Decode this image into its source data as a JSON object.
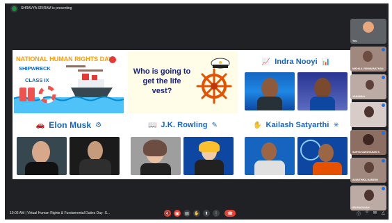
{
  "presenting_text": "SHRAVYA SRIRAM is presenting",
  "meeting": {
    "time": "10:02 AM",
    "title": "Virtual Human Rights & Fundamental Duties Day -S..."
  },
  "slide": {
    "panel1": {
      "line1": "NATIONAL HUMAN RIGHTS DAY",
      "line2": "SHIPWRECK",
      "line3": "CLASS IX"
    },
    "panel2": {
      "question": "Who is going to get the life vest?"
    },
    "panel3": {
      "name": "Indra Nooyi"
    },
    "panel4": {
      "name": "Elon Musk"
    },
    "panel5": {
      "name": "J.K. Rowling"
    },
    "panel6": {
      "name": "Kailash Satyarthi"
    }
  },
  "participants": [
    {
      "name": "You"
    },
    {
      "name": "NIKHILA VISHWANATHAN"
    },
    {
      "name": "VANSHIKA"
    },
    {
      "name": ""
    },
    {
      "name": "SURYA NARAYANAN S"
    },
    {
      "name": "AVANTHIKA GANESH"
    },
    {
      "name": "SRI RAGAVAN"
    }
  ],
  "colors": {
    "accent": "#1565c0",
    "banner": "#f59e0b",
    "end_call": "#ea4335",
    "control_off": "#ea4335"
  }
}
